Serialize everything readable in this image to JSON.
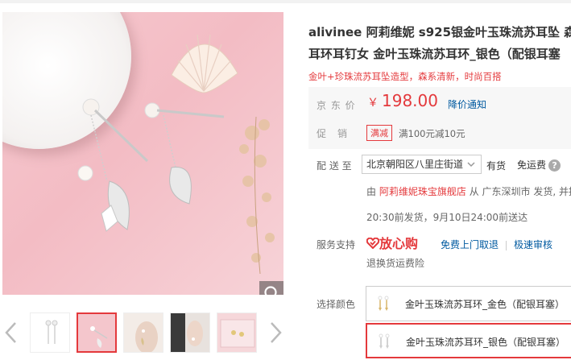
{
  "product": {
    "title_line1": "alivinee 阿莉维妮 s925银金叶玉珠流苏耳坠 森",
    "title_line2": "耳环耳钉女 金叶玉珠流苏耳环_银色（配银耳塞",
    "subtitle": "金叶+珍珠流苏耳坠造型，森系清新，时尚百搭"
  },
  "price": {
    "label": "京 东 价",
    "currency": "￥",
    "value": "198.00",
    "notify": "降价通知"
  },
  "promo": {
    "label": "促　销",
    "tag": "满减",
    "text": "满100元减10元"
  },
  "delivery": {
    "label": "配 送 至",
    "address": "北京朝阳区八里庄街道",
    "stock": "有货",
    "free_shipping": "免运费",
    "from_prefix": "由",
    "store": "阿莉维妮珠宝旗舰店",
    "from_suffix": "从 广东深圳市 发货, 并提",
    "schedule": "20:30前发货，9月10日24:00前送达"
  },
  "service": {
    "label": "服务支持",
    "badge": "放心购",
    "pickup": "免费上门取退",
    "audit": "极速审核",
    "insurance": "退换货运费险"
  },
  "colors": {
    "label": "选择颜色",
    "options": [
      {
        "name": "金叶玉珠流苏耳环_金色（配银耳塞）",
        "selected": false
      },
      {
        "name": "金叶玉珠流苏耳环_银色（配银耳塞）",
        "selected": true
      }
    ]
  },
  "gallery": {
    "thumb_count": 5,
    "active_index": 1
  },
  "colors_theme": {
    "accent": "#e4393c",
    "link": "#005aa0"
  }
}
